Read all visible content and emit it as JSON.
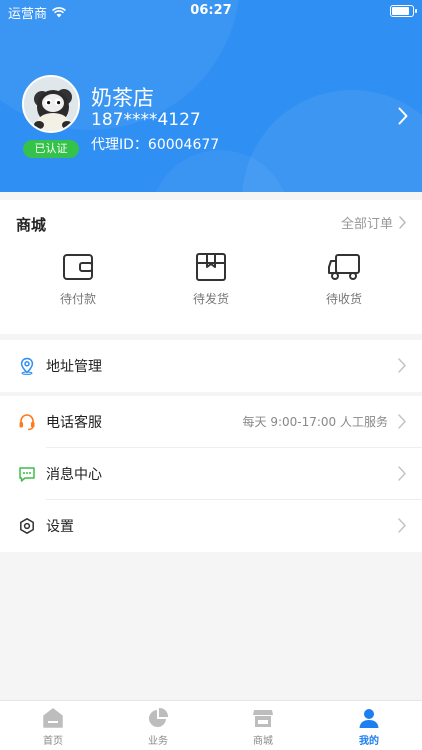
{
  "status_bar": {
    "carrier": "运营商",
    "time": "06:27",
    "battery": 0.9
  },
  "profile": {
    "name": "奶茶店",
    "phone": "187****4127",
    "agent_id": "代理ID：60004677",
    "verified_badge": "已认证"
  },
  "mall": {
    "title": "商城",
    "all_orders": "全部订单",
    "orders": [
      {
        "label": "待付款",
        "icon": "wallet-icon"
      },
      {
        "label": "待发货",
        "icon": "package-icon"
      },
      {
        "label": "待收货",
        "icon": "truck-icon"
      }
    ]
  },
  "menu": {
    "address": {
      "label": "地址管理",
      "icon": "location-icon"
    },
    "service": {
      "label": "电话客服",
      "value": "每天 9:00-17:00 人工服务",
      "icon": "headset-icon"
    },
    "messages": {
      "label": "消息中心",
      "icon": "message-icon"
    },
    "settings": {
      "label": "设置",
      "icon": "settings-icon"
    }
  },
  "tabbar": {
    "items": [
      {
        "label": "首页",
        "icon": "home-icon"
      },
      {
        "label": "业务",
        "icon": "pie-chart-icon"
      },
      {
        "label": "商城",
        "icon": "store-icon"
      },
      {
        "label": "我的",
        "icon": "user-icon"
      }
    ],
    "active_index": 3
  },
  "colors": {
    "brand_blue": "#2f8ff2",
    "verified_green": "#35c24a",
    "active_tab": "#1e7ff0"
  }
}
